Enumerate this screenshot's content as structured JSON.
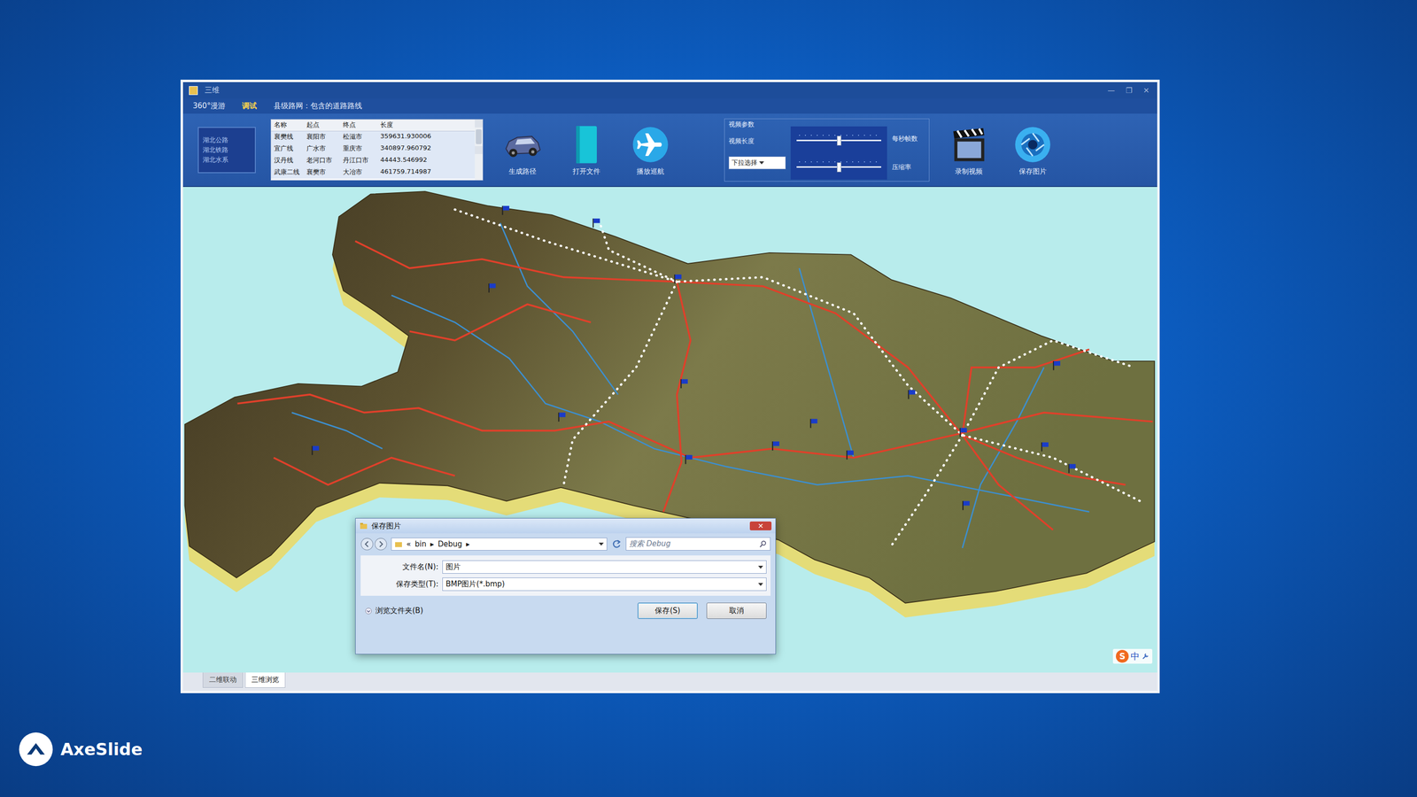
{
  "slide": {
    "logo": "AxeSlide"
  },
  "window": {
    "title": "三维",
    "controls": [
      "—",
      "❐",
      "✕"
    ]
  },
  "menu": [
    {
      "label": "360°漫游",
      "selected": false
    },
    {
      "label": "调试",
      "selected": true
    },
    {
      "label": "县级路网：包含的道路路线",
      "selected": false
    }
  ],
  "layer_list": [
    "湖北公路",
    "湖北铁路",
    "湖北水系"
  ],
  "route_table": {
    "columns": [
      "名称",
      "起点",
      "终点",
      "长度"
    ],
    "rows": [
      [
        "襄樊线",
        "襄阳市",
        "松滋市",
        "359631.930006"
      ],
      [
        "宜广线",
        "广水市",
        "重庆市",
        "340897.960792"
      ],
      [
        "汉丹线",
        "老河口市",
        "丹江口市",
        "44443.546992"
      ],
      [
        "武康二线",
        "襄樊市",
        "大冶市",
        "461759.714987"
      ]
    ]
  },
  "tools": [
    {
      "label": "生成路径",
      "kind": "car"
    },
    {
      "label": "打开文件",
      "kind": "book"
    },
    {
      "label": "播放巡航",
      "kind": "plane"
    }
  ],
  "video_params": {
    "title": "视频参数",
    "length_label": "视频长度",
    "dropdown": "下拉选择",
    "sliders": [
      {
        "label": "每秒帧数",
        "level": 0.5
      },
      {
        "label": "压缩率",
        "level": 0.5
      }
    ]
  },
  "media_tools": [
    {
      "label": "录制视频",
      "kind": "clapper"
    },
    {
      "label": "保存图片",
      "kind": "aperture"
    }
  ],
  "save_dialog": {
    "title": "保存图片",
    "close": "✕",
    "path": [
      "«",
      "bin",
      "▸",
      "Debug",
      "▸"
    ],
    "search_placeholder": "搜索 Debug",
    "fields": [
      {
        "label": "文件名(N):",
        "value": "图片"
      },
      {
        "label": "保存类型(T):",
        "value": "BMP图片(*.bmp)"
      }
    ],
    "browse": "浏览文件夹(B)",
    "buttons": [
      "保存(S)",
      "取消"
    ]
  },
  "view_tabs": [
    {
      "label": "二维联动",
      "selected": false
    },
    {
      "label": "三维浏览",
      "selected": true
    }
  ],
  "ime": {
    "logo": "S",
    "mode": "中"
  }
}
